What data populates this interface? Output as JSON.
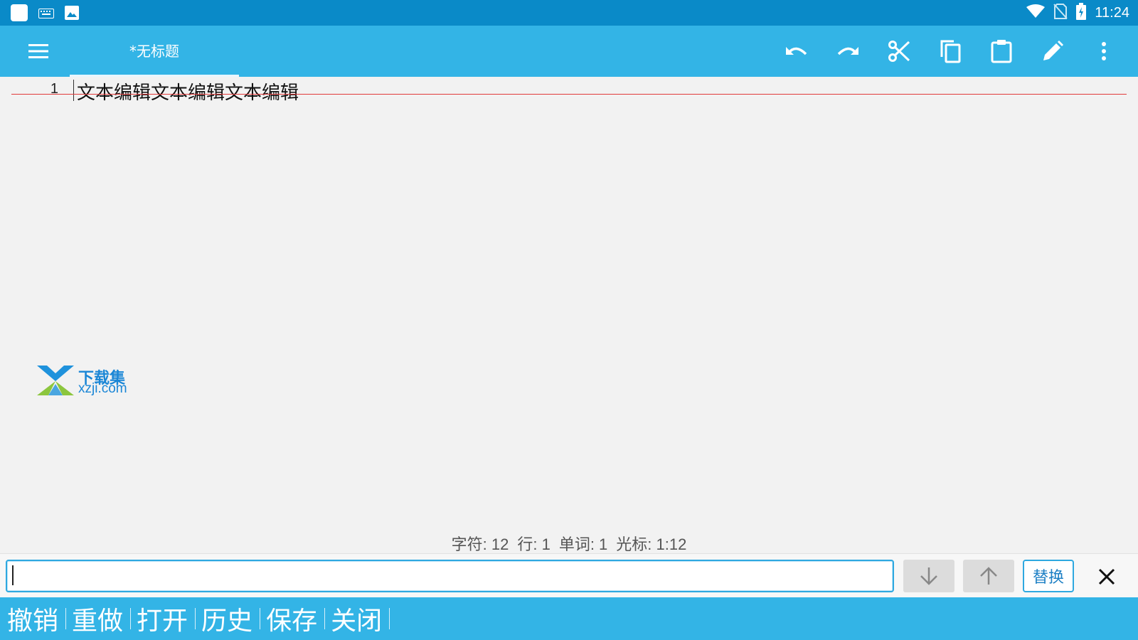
{
  "status_bar": {
    "left_icons": [
      "app-square-icon",
      "keyboard-icon",
      "image-icon"
    ],
    "right_icons": [
      "wifi-icon",
      "no-sim-icon",
      "battery-charging-icon"
    ],
    "time": "11:24"
  },
  "toolbar": {
    "tab_title": "*无标题",
    "actions": [
      "undo-icon",
      "redo-icon",
      "scissors-icon",
      "copy-icon",
      "clipboard-icon",
      "pencil-icon",
      "more-vert-icon"
    ]
  },
  "editor": {
    "lines": [
      {
        "number": "1",
        "text": "文本编辑文本编辑文本编辑"
      }
    ]
  },
  "watermark": {
    "brand": "下载集",
    "url": "xzji.com"
  },
  "stats": {
    "chars": "字符: 12",
    "lines": "行: 1",
    "words": "单词: 1",
    "cursor": "光标: 1:12"
  },
  "search": {
    "value": "",
    "replace_label": "替换"
  },
  "bottom_bar": {
    "items": [
      "撤销",
      "重做",
      "打开",
      "历史",
      "保存",
      "关闭"
    ]
  },
  "colors": {
    "status_bar": "#0a8ac8",
    "toolbar": "#33b4e6",
    "accent": "#2ea8e0",
    "line_rule": "#e23a3a"
  }
}
